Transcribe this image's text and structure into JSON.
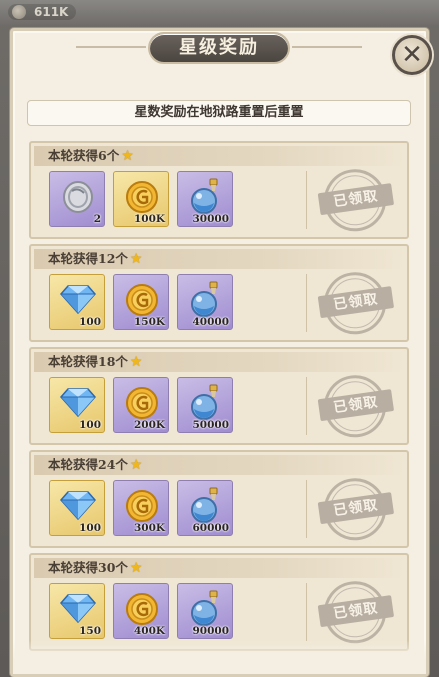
{
  "top_currency": {
    "value": "611K"
  },
  "window": {
    "title": "星级奖励",
    "close_label": "✕",
    "notice": "星数奖励在地狱路重置后重置"
  },
  "tiers": [
    {
      "label": "本轮获得6个",
      "stamp": "已领取",
      "items": [
        {
          "icon": "silver-coin-icon",
          "frame": "purple",
          "qty": "2"
        },
        {
          "icon": "gold-coin-icon",
          "frame": "gold",
          "qty": "100K"
        },
        {
          "icon": "potion-icon",
          "frame": "purple",
          "qty": "30000"
        }
      ]
    },
    {
      "label": "本轮获得12个",
      "stamp": "已领取",
      "items": [
        {
          "icon": "diamond-icon",
          "frame": "gold",
          "qty": "100"
        },
        {
          "icon": "gold-coin-icon",
          "frame": "purple",
          "qty": "150K"
        },
        {
          "icon": "potion-icon",
          "frame": "purple",
          "qty": "40000"
        }
      ]
    },
    {
      "label": "本轮获得18个",
      "stamp": "已领取",
      "items": [
        {
          "icon": "diamond-icon",
          "frame": "gold",
          "qty": "100"
        },
        {
          "icon": "gold-coin-icon",
          "frame": "purple",
          "qty": "200K"
        },
        {
          "icon": "potion-icon",
          "frame": "purple",
          "qty": "50000"
        }
      ]
    },
    {
      "label": "本轮获得24个",
      "stamp": "已领取",
      "items": [
        {
          "icon": "diamond-icon",
          "frame": "gold",
          "qty": "100"
        },
        {
          "icon": "gold-coin-icon",
          "frame": "purple",
          "qty": "300K"
        },
        {
          "icon": "potion-icon",
          "frame": "purple",
          "qty": "60000"
        }
      ]
    },
    {
      "label": "本轮获得30个",
      "stamp": "已领取",
      "items": [
        {
          "icon": "diamond-icon",
          "frame": "gold",
          "qty": "150"
        },
        {
          "icon": "gold-coin-icon",
          "frame": "purple",
          "qty": "400K"
        },
        {
          "icon": "potion-icon",
          "frame": "purple",
          "qty": "90000"
        }
      ]
    }
  ],
  "colors": {
    "panel": "#f5efe3",
    "title_plate": "#4b4540",
    "star": "#f0b71d",
    "purple_frame": "#9f8cd0",
    "gold_frame": "#e7c76c",
    "stamp": "#b8aea2"
  }
}
